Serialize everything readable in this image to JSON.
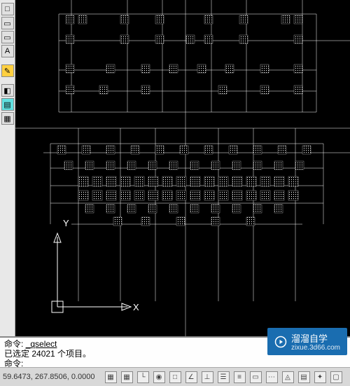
{
  "toolbar": {
    "tools": [
      {
        "name": "general-tool",
        "glyph": "□"
      },
      {
        "name": "properties-tool",
        "glyph": "▭"
      },
      {
        "name": "modify-tool",
        "glyph": "▭"
      },
      {
        "name": "text-tool",
        "glyph": "A"
      },
      {
        "name": "break1",
        "glyph": ""
      },
      {
        "name": "highlight-tool",
        "glyph": "✎",
        "variant": "yellow"
      },
      {
        "name": "break2",
        "glyph": ""
      },
      {
        "name": "palette-tool",
        "glyph": "◧"
      },
      {
        "name": "grid-tool",
        "glyph": "▤",
        "variant": "cyan"
      },
      {
        "name": "select-tool",
        "glyph": "▦"
      }
    ]
  },
  "ucs": {
    "x_label": "X",
    "y_label": "Y"
  },
  "command": {
    "line1_prefix": "命令: ",
    "line1_cmd": "_qselect",
    "line2_prefix": "已选定 ",
    "line2_count": "24021",
    "line2_suffix": " 个项目。",
    "prompt": "命令:"
  },
  "status": {
    "coords": "59.6473, 267.8506, 0.0000",
    "buttons": [
      {
        "name": "snap",
        "glyph": "▦"
      },
      {
        "name": "grid",
        "glyph": "▦"
      },
      {
        "name": "ortho",
        "glyph": "└"
      },
      {
        "name": "polar",
        "glyph": "◉"
      },
      {
        "name": "osnap",
        "glyph": "□"
      },
      {
        "name": "otrack",
        "glyph": "∠"
      },
      {
        "name": "ducs",
        "glyph": "⊥"
      },
      {
        "name": "dyn",
        "glyph": "☰"
      },
      {
        "name": "lwt",
        "glyph": "≡"
      },
      {
        "name": "qp",
        "glyph": "▭"
      },
      {
        "name": "annoscale",
        "glyph": "⋯"
      },
      {
        "name": "annovis",
        "glyph": "◬"
      },
      {
        "name": "autoscale",
        "glyph": "▤"
      },
      {
        "name": "workspace",
        "glyph": "✦"
      },
      {
        "name": "model",
        "glyph": "▢"
      }
    ]
  },
  "watermark": {
    "brand": "溜溜自学",
    "url": "zixue.3d66.com"
  }
}
